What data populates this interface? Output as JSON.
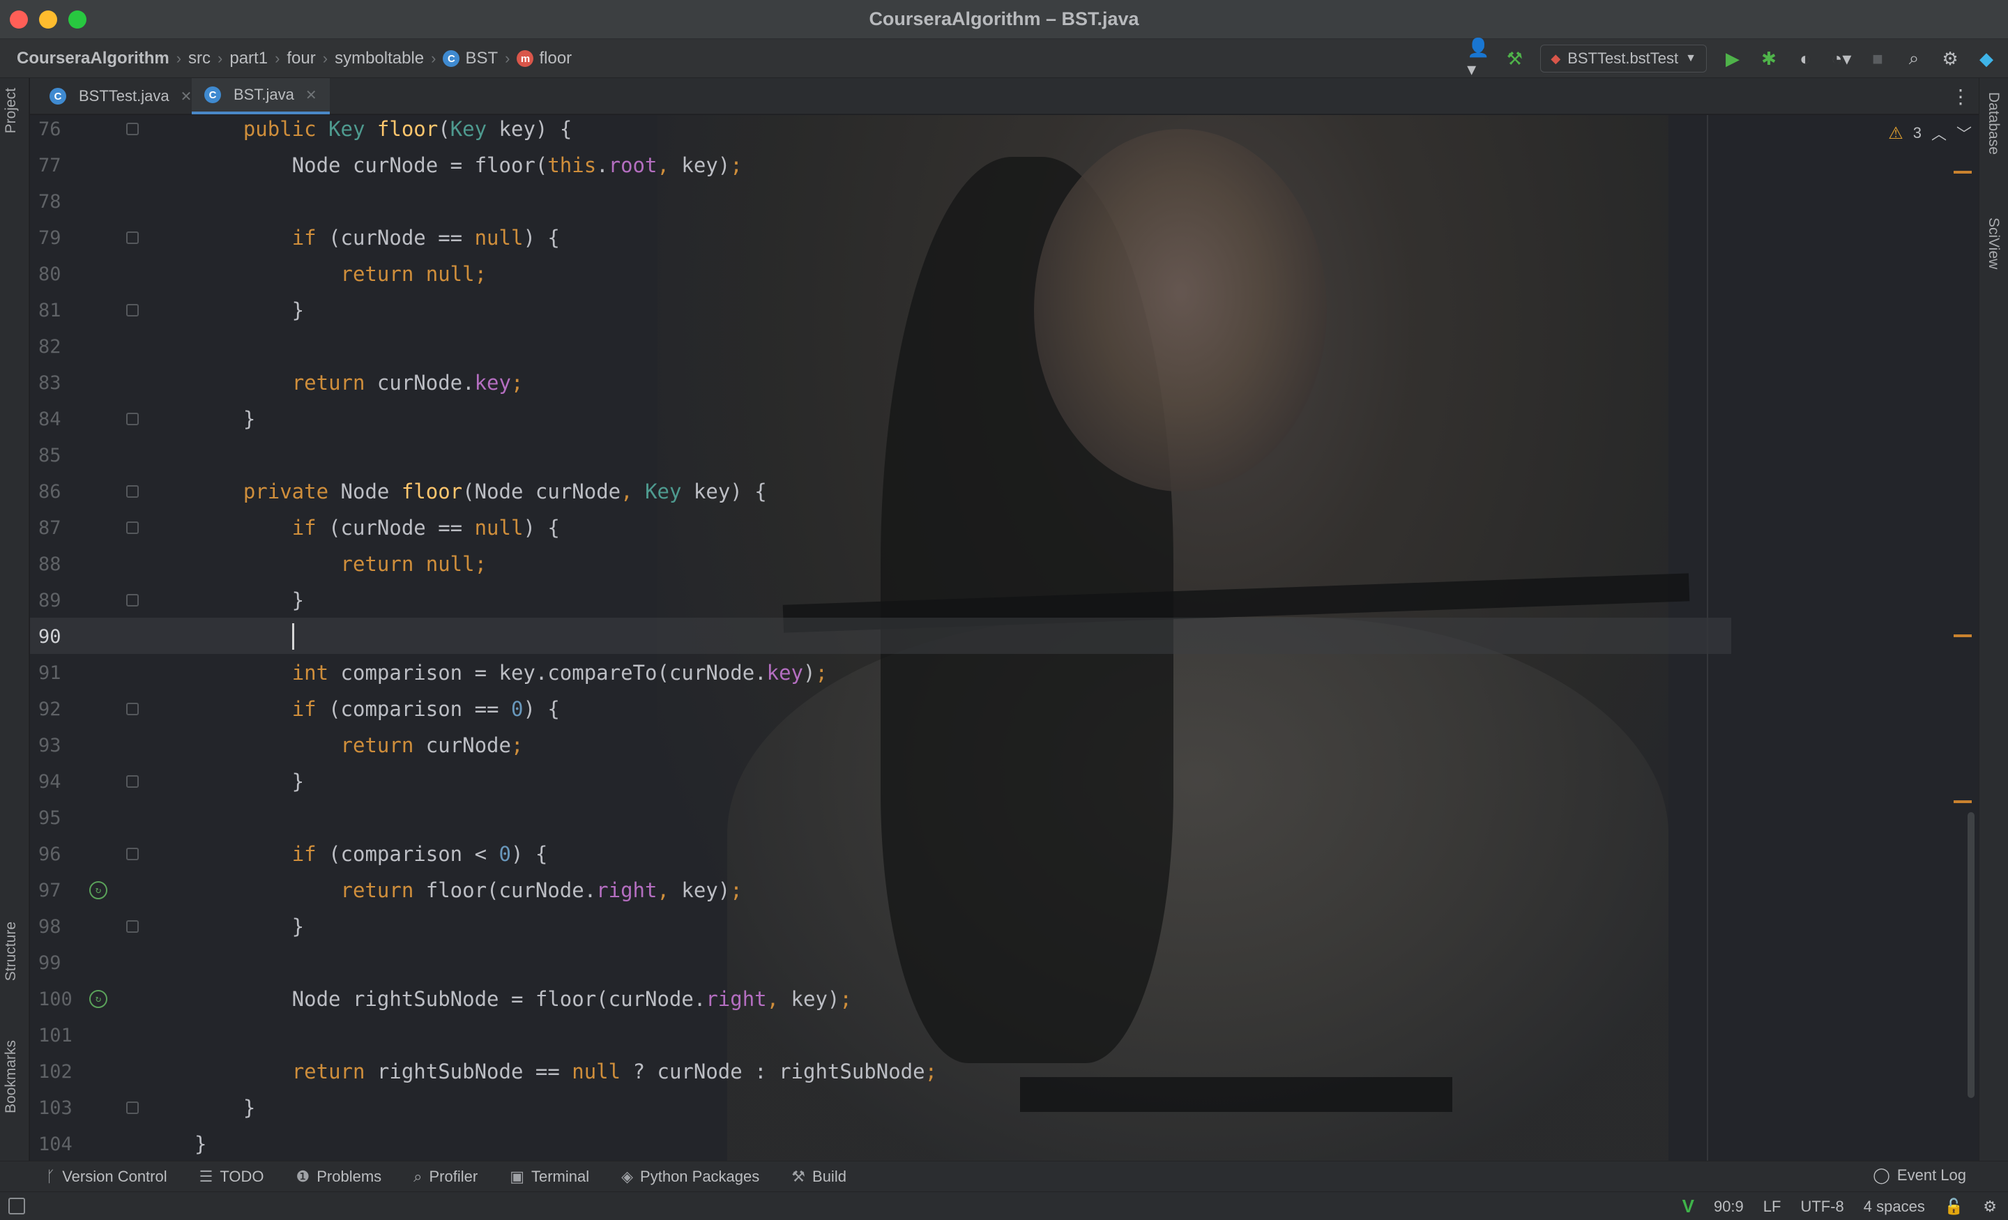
{
  "window": {
    "title": "CourseraAlgorithm – BST.java"
  },
  "breadcrumbs": [
    {
      "label": "CourseraAlgorithm",
      "bold": true
    },
    {
      "label": "src"
    },
    {
      "label": "part1"
    },
    {
      "label": "four"
    },
    {
      "label": "symboltable"
    },
    {
      "label": "BST",
      "badge": "C"
    },
    {
      "label": "floor",
      "badge": "m"
    }
  ],
  "toolbar": {
    "run_config": "BSTTest.bstTest",
    "icons": [
      "user-icon",
      "hammer-icon",
      "run-icon",
      "debug-icon",
      "coverage-icon",
      "profile-icon",
      "stop-icon",
      "search-icon",
      "gear-icon",
      "jetbrains-icon"
    ]
  },
  "left_stripe": {
    "project": "Project",
    "structure": "Structure",
    "bookmarks": "Bookmarks"
  },
  "right_stripe": {
    "database": "Database",
    "sciview": "SciView"
  },
  "tabs": [
    {
      "label": "BSTTest.java",
      "badge": "C",
      "active": false
    },
    {
      "label": "BST.java",
      "badge": "C",
      "active": true
    }
  ],
  "editor": {
    "warnings_count": "3",
    "current_line": "90",
    "cursor": "90:9",
    "lines": [
      {
        "n": "76",
        "tokens": [
          [
            "    public ",
            "kw"
          ],
          [
            "Key ",
            "ty"
          ],
          [
            "floor",
            "fn"
          ],
          [
            "(",
            "pl"
          ],
          [
            "Key ",
            "ty"
          ],
          [
            "key) {",
            "pl"
          ]
        ],
        "fold": true
      },
      {
        "n": "77",
        "tokens": [
          [
            "        Node curNode = floor(",
            "pl"
          ],
          [
            "this",
            "kw"
          ],
          [
            ".",
            "pl"
          ],
          [
            "root",
            "fld"
          ],
          [
            ", ",
            "kw"
          ],
          [
            "key)",
            "pl"
          ],
          [
            ";",
            "kw"
          ]
        ]
      },
      {
        "n": "78",
        "tokens": []
      },
      {
        "n": "79",
        "tokens": [
          [
            "        ",
            "pl"
          ],
          [
            "if ",
            "kw"
          ],
          [
            "(curNode == ",
            "pl"
          ],
          [
            "null",
            "kw"
          ],
          [
            ") {",
            "pl"
          ]
        ],
        "fold": true
      },
      {
        "n": "80",
        "tokens": [
          [
            "            ",
            "pl"
          ],
          [
            "return null;",
            "kw"
          ]
        ]
      },
      {
        "n": "81",
        "tokens": [
          [
            "        }",
            "pl"
          ]
        ],
        "fold": true
      },
      {
        "n": "82",
        "tokens": []
      },
      {
        "n": "83",
        "tokens": [
          [
            "        ",
            "pl"
          ],
          [
            "return ",
            "kw"
          ],
          [
            "curNode.",
            "pl"
          ],
          [
            "key",
            "fld"
          ],
          [
            ";",
            "kw"
          ]
        ]
      },
      {
        "n": "84",
        "tokens": [
          [
            "    }",
            "pl"
          ]
        ],
        "fold": true
      },
      {
        "n": "85",
        "tokens": []
      },
      {
        "n": "86",
        "tokens": [
          [
            "    ",
            "pl"
          ],
          [
            "private ",
            "kw"
          ],
          [
            "Node ",
            "pl"
          ],
          [
            "floor",
            "fn"
          ],
          [
            "(Node curNode",
            "pl"
          ],
          [
            ", ",
            "kw"
          ],
          [
            "Key ",
            "ty"
          ],
          [
            "key) {",
            "pl"
          ]
        ],
        "fold": true
      },
      {
        "n": "87",
        "tokens": [
          [
            "        ",
            "pl"
          ],
          [
            "if ",
            "kw"
          ],
          [
            "(curNode == ",
            "pl"
          ],
          [
            "null",
            "kw"
          ],
          [
            ") {",
            "pl"
          ]
        ],
        "fold": true
      },
      {
        "n": "88",
        "tokens": [
          [
            "            ",
            "pl"
          ],
          [
            "return null;",
            "kw"
          ]
        ]
      },
      {
        "n": "89",
        "tokens": [
          [
            "        }",
            "pl"
          ]
        ],
        "fold": true
      },
      {
        "n": "90",
        "tokens": [
          [
            "        ",
            "pl"
          ]
        ],
        "caret": true
      },
      {
        "n": "91",
        "tokens": [
          [
            "        ",
            "pl"
          ],
          [
            "int ",
            "kw"
          ],
          [
            "comparison = key.compareTo(curNode.",
            "pl"
          ],
          [
            "key",
            "fld"
          ],
          [
            ")",
            "pl"
          ],
          [
            ";",
            "kw"
          ]
        ]
      },
      {
        "n": "92",
        "tokens": [
          [
            "        ",
            "pl"
          ],
          [
            "if ",
            "kw"
          ],
          [
            "(comparison == ",
            "pl"
          ],
          [
            "0",
            "num"
          ],
          [
            ") {",
            "pl"
          ]
        ],
        "fold": true
      },
      {
        "n": "93",
        "tokens": [
          [
            "            ",
            "pl"
          ],
          [
            "return ",
            "kw"
          ],
          [
            "curNode",
            "pl"
          ],
          [
            ";",
            "kw"
          ]
        ]
      },
      {
        "n": "94",
        "tokens": [
          [
            "        }",
            "pl"
          ]
        ],
        "fold": true
      },
      {
        "n": "95",
        "tokens": []
      },
      {
        "n": "96",
        "tokens": [
          [
            "        ",
            "pl"
          ],
          [
            "if ",
            "kw"
          ],
          [
            "(comparison < ",
            "pl"
          ],
          [
            "0",
            "num"
          ],
          [
            ") {",
            "pl"
          ]
        ],
        "fold": true
      },
      {
        "n": "97",
        "tokens": [
          [
            "            ",
            "pl"
          ],
          [
            "return ",
            "kw"
          ],
          [
            "floor(curNode.",
            "pl"
          ],
          [
            "right",
            "fld"
          ],
          [
            ", ",
            "kw"
          ],
          [
            "key)",
            "pl"
          ],
          [
            ";",
            "kw"
          ]
        ],
        "recursion": true
      },
      {
        "n": "98",
        "tokens": [
          [
            "        }",
            "pl"
          ]
        ],
        "fold": true
      },
      {
        "n": "99",
        "tokens": []
      },
      {
        "n": "100",
        "tokens": [
          [
            "        Node rightSubNode = floor(curNode.",
            "pl"
          ],
          [
            "right",
            "fld"
          ],
          [
            ", ",
            "kw"
          ],
          [
            "key)",
            "pl"
          ],
          [
            ";",
            "kw"
          ]
        ],
        "recursion": true
      },
      {
        "n": "101",
        "tokens": []
      },
      {
        "n": "102",
        "tokens": [
          [
            "        ",
            "pl"
          ],
          [
            "return ",
            "kw"
          ],
          [
            "rightSubNode == ",
            "pl"
          ],
          [
            "null ",
            "kw"
          ],
          [
            "? curNode : rightSubNode",
            "pl"
          ],
          [
            ";",
            "kw"
          ]
        ]
      },
      {
        "n": "103",
        "tokens": [
          [
            "    }",
            "pl"
          ]
        ],
        "fold": true
      },
      {
        "n": "104",
        "tokens": [
          [
            "}",
            "pl"
          ]
        ]
      }
    ]
  },
  "bottom_tools": [
    {
      "label": "Version Control",
      "icon": "branch-icon",
      "glyph": "ᚴ"
    },
    {
      "label": "TODO",
      "icon": "list-icon",
      "glyph": "☰"
    },
    {
      "label": "Problems",
      "icon": "info-icon",
      "glyph": "❶"
    },
    {
      "label": "Profiler",
      "icon": "profiler-icon",
      "glyph": "⌕"
    },
    {
      "label": "Terminal",
      "icon": "terminal-icon",
      "glyph": "▣"
    },
    {
      "label": "Python Packages",
      "icon": "layers-icon",
      "glyph": "◈"
    },
    {
      "label": "Build",
      "icon": "hammer-icon",
      "glyph": "⚒"
    }
  ],
  "event_log": "Event Log",
  "status": {
    "position": "90:9",
    "line_sep": "LF",
    "encoding": "UTF-8",
    "indent": "4 spaces"
  }
}
